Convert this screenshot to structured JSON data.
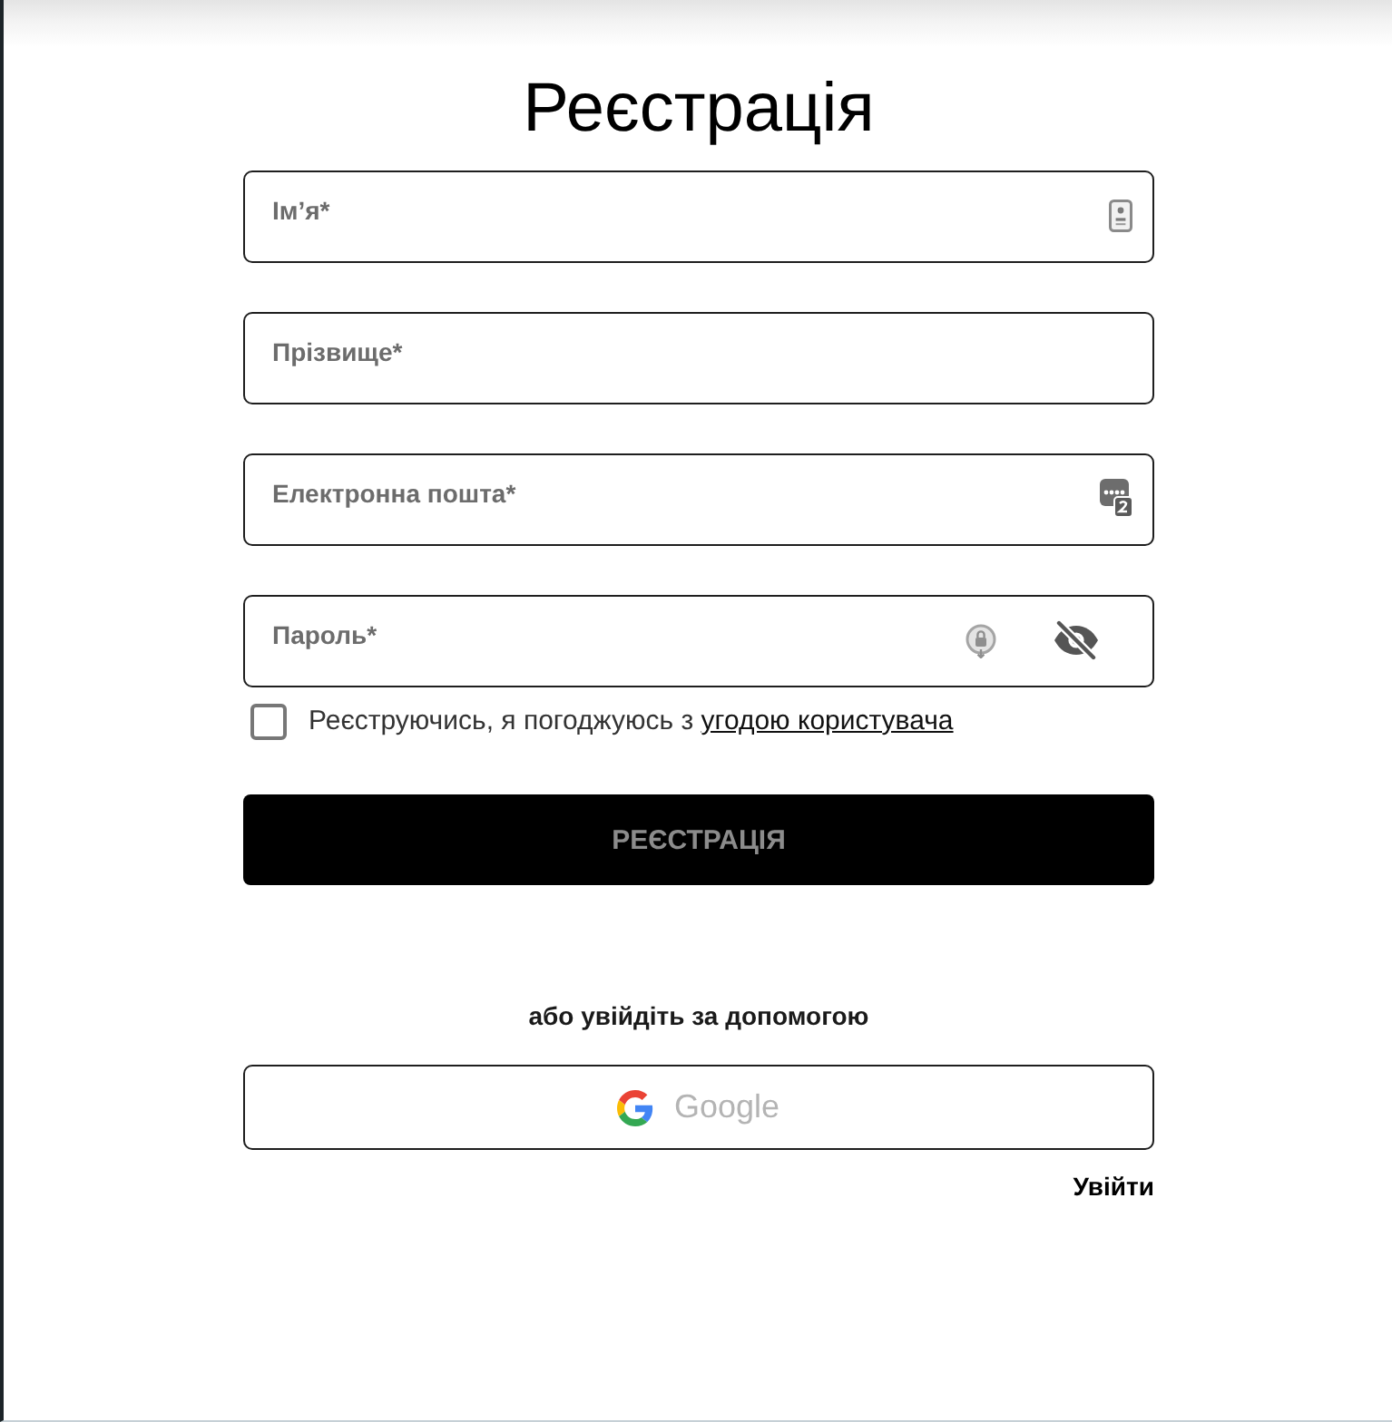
{
  "title": "Реєстрація",
  "fields": [
    {
      "kind": "name",
      "placeholder": "Ім’я*"
    },
    {
      "kind": "surname",
      "placeholder": "Прізвище*"
    },
    {
      "kind": "email",
      "placeholder": "Електронна пошта*"
    },
    {
      "kind": "password",
      "placeholder": "Пароль*"
    }
  ],
  "agreement": {
    "checked": false,
    "text": "Реєструючись, я погоджуюсь з",
    "link": "угодою користувача"
  },
  "submit_button": {
    "label": "РЕЄСТРАЦІЯ",
    "disabled": true
  },
  "alt_login_text": "або увійдіть за допомогою",
  "google_button": {
    "label": "Google"
  },
  "login_link": "Увійти"
}
